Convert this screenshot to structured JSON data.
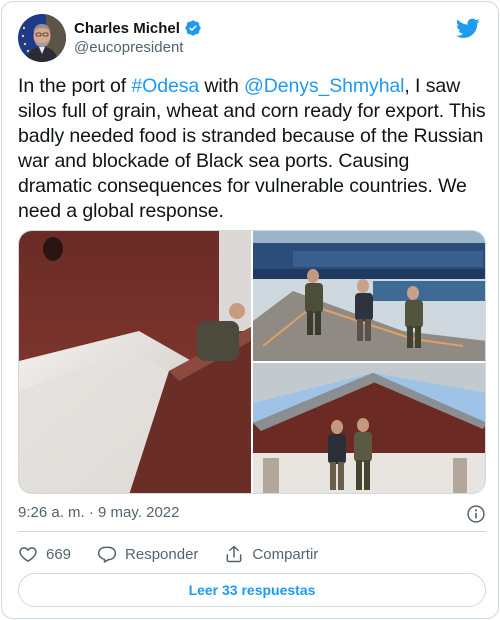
{
  "author": {
    "name": "Charles Michel",
    "handle": "@eucopresident",
    "verified": true
  },
  "tweet": {
    "text_prefix": "In the port of ",
    "hashtag": "#Odesa",
    "text_middle": " with ",
    "mention": "@Denys_Shmyhal",
    "text_suffix": ", I saw silos full of grain, wheat and corn ready for export. This badly needed food is stranded because of the Russian war and blockade of Black sea ports. Causing dramatic consequences for vulnerable countries. We need a global response."
  },
  "meta": {
    "timestamp": "9:26 a. m. · 9 may. 2022"
  },
  "actions": {
    "like_count": "669",
    "reply_label": "Responder",
    "share_label": "Compartir"
  },
  "replies_button": "Leer 33 respuestas",
  "colors": {
    "accent": "#1d9bf0",
    "text": "#0f1419",
    "secondary": "#536471",
    "border": "#cfd9de"
  },
  "icons": [
    "twitter-bird-icon",
    "verified-badge-icon",
    "info-icon",
    "heart-icon",
    "reply-bubble-icon",
    "share-icon"
  ]
}
